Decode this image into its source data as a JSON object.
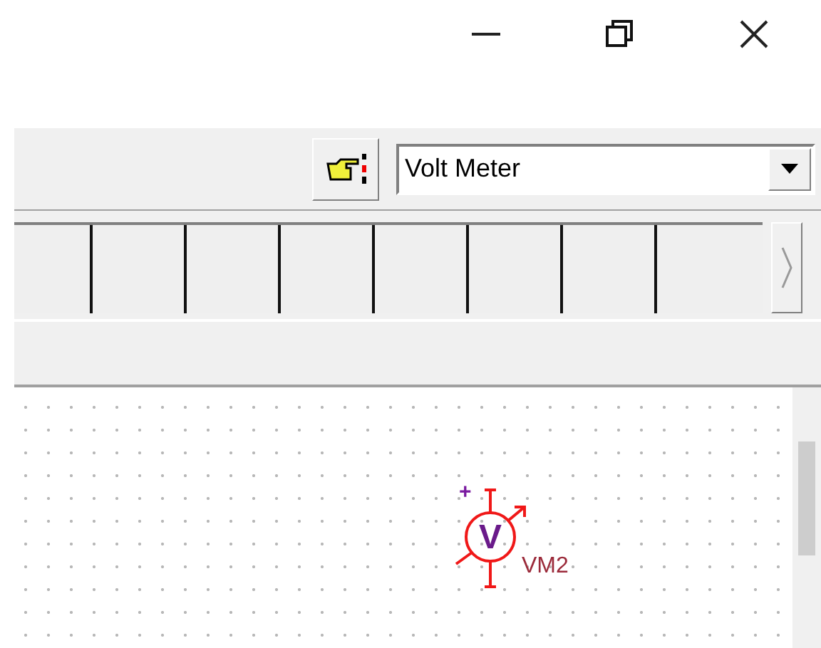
{
  "toolbar": {
    "component_select": {
      "value": "Volt Meter"
    }
  },
  "schematic": {
    "components": [
      {
        "kind": "voltmeter",
        "symbol": "V",
        "polarity": "+",
        "label": "VM2"
      }
    ]
  }
}
